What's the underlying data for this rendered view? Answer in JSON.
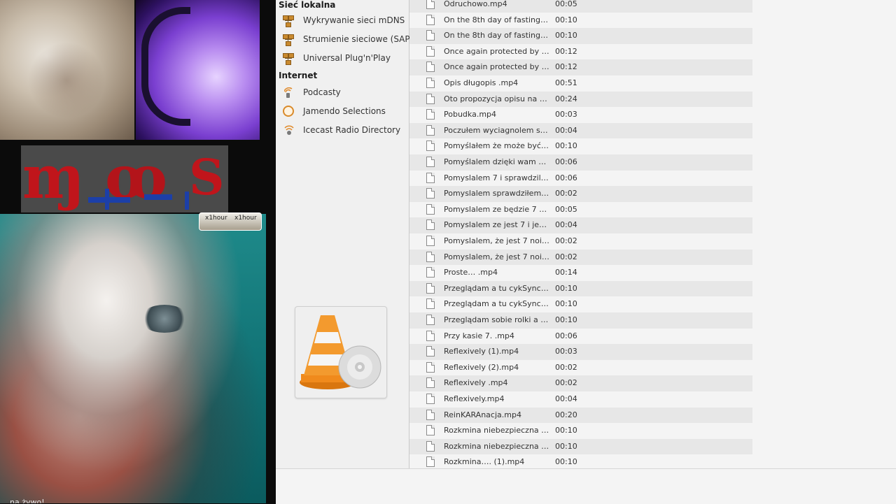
{
  "video_collage": {
    "overlay_labels": [
      "x1hour",
      "x1hour"
    ],
    "caption": "na żywo!"
  },
  "sidebar": {
    "sections": [
      {
        "title": "Sieć lokalna",
        "items": [
          {
            "label": "Wykrywanie sieci mDNS",
            "icon": "network-icon"
          },
          {
            "label": "Strumienie sieciowe (SAP)",
            "icon": "network-icon"
          },
          {
            "label": "Universal Plug'n'Play",
            "icon": "network-icon"
          }
        ]
      },
      {
        "title": "Internet",
        "items": [
          {
            "label": "Podcasty",
            "icon": "podcast-icon"
          },
          {
            "label": "Jamendo Selections",
            "icon": "jamendo-icon"
          },
          {
            "label": "Icecast Radio Directory",
            "icon": "icecast-icon"
          }
        ]
      }
    ]
  },
  "playlist": {
    "rows": [
      {
        "name": "Odruchowo.mp4",
        "duration": "00:05"
      },
      {
        "name": "On the 8th day of fasting, y...",
        "duration": "00:10"
      },
      {
        "name": "On the 8th day of fasting, y...",
        "duration": "00:10"
      },
      {
        "name": "Once again protected by the...",
        "duration": "00:12"
      },
      {
        "name": "Once again protected by the...",
        "duration": "00:12"
      },
      {
        "name": "Opis długopis .mp4",
        "duration": "00:51"
      },
      {
        "name": "Oto propozycja opisu na Tik...",
        "duration": "00:24"
      },
      {
        "name": "Pobudka.mp4",
        "duration": "00:03"
      },
      {
        "name": "Poczułem wyciagnolem spra...",
        "duration": "00:04"
      },
      {
        "name": "Pomyślałem że może być sie...",
        "duration": "00:10"
      },
      {
        "name": "Pomyślalem dzięki wam Ojcz...",
        "duration": "00:06"
      },
      {
        "name": "Pomyslalem 7 i sprawdzilem i ...",
        "duration": "00:06"
      },
      {
        "name": "Pomyslalem sprawdziłem i 7...",
        "duration": "00:02"
      },
      {
        "name": "Pomyslalem ze będzie 7 wyci...",
        "duration": "00:05"
      },
      {
        "name": "Pomyslalem ze jest 7 i jest 7 ...",
        "duration": "00:04"
      },
      {
        "name": "Pomyslalem, że jest 7 noi 7. ...",
        "duration": "00:02"
      },
      {
        "name": "Pomyslalem, że jest 7 noi 7. ...",
        "duration": "00:02"
      },
      {
        "name": "Proste… .mp4",
        "duration": "00:14"
      },
      {
        "name": "Przeglądam a tu cykSync. (...",
        "duration": "00:10"
      },
      {
        "name": "Przeglądam a tu cykSync. .m...",
        "duration": "00:10"
      },
      {
        "name": "Przeglądam sobie rolki a tu c...",
        "duration": "00:10"
      },
      {
        "name": "Przy kasie 7. .mp4",
        "duration": "00:06"
      },
      {
        "name": "Reflexively  (1).mp4",
        "duration": "00:03"
      },
      {
        "name": "Reflexively  (2).mp4",
        "duration": "00:02"
      },
      {
        "name": "Reflexively .mp4",
        "duration": "00:02"
      },
      {
        "name": "Reflexively.mp4",
        "duration": "00:04"
      },
      {
        "name": "ReinKARAnacja.mp4",
        "duration": "00:20"
      },
      {
        "name": "Rozkmina niebezpieczna min...",
        "duration": "00:10"
      },
      {
        "name": "Rozkmina niebezpieczna min...",
        "duration": "00:10"
      },
      {
        "name": "Rozkmina….  (1).mp4",
        "duration": "00:10"
      }
    ]
  },
  "colors": {
    "row_alt": "#e7e7e7",
    "panel_bg": "#f4f4f4",
    "vlc_orange": "#f08a1c"
  }
}
